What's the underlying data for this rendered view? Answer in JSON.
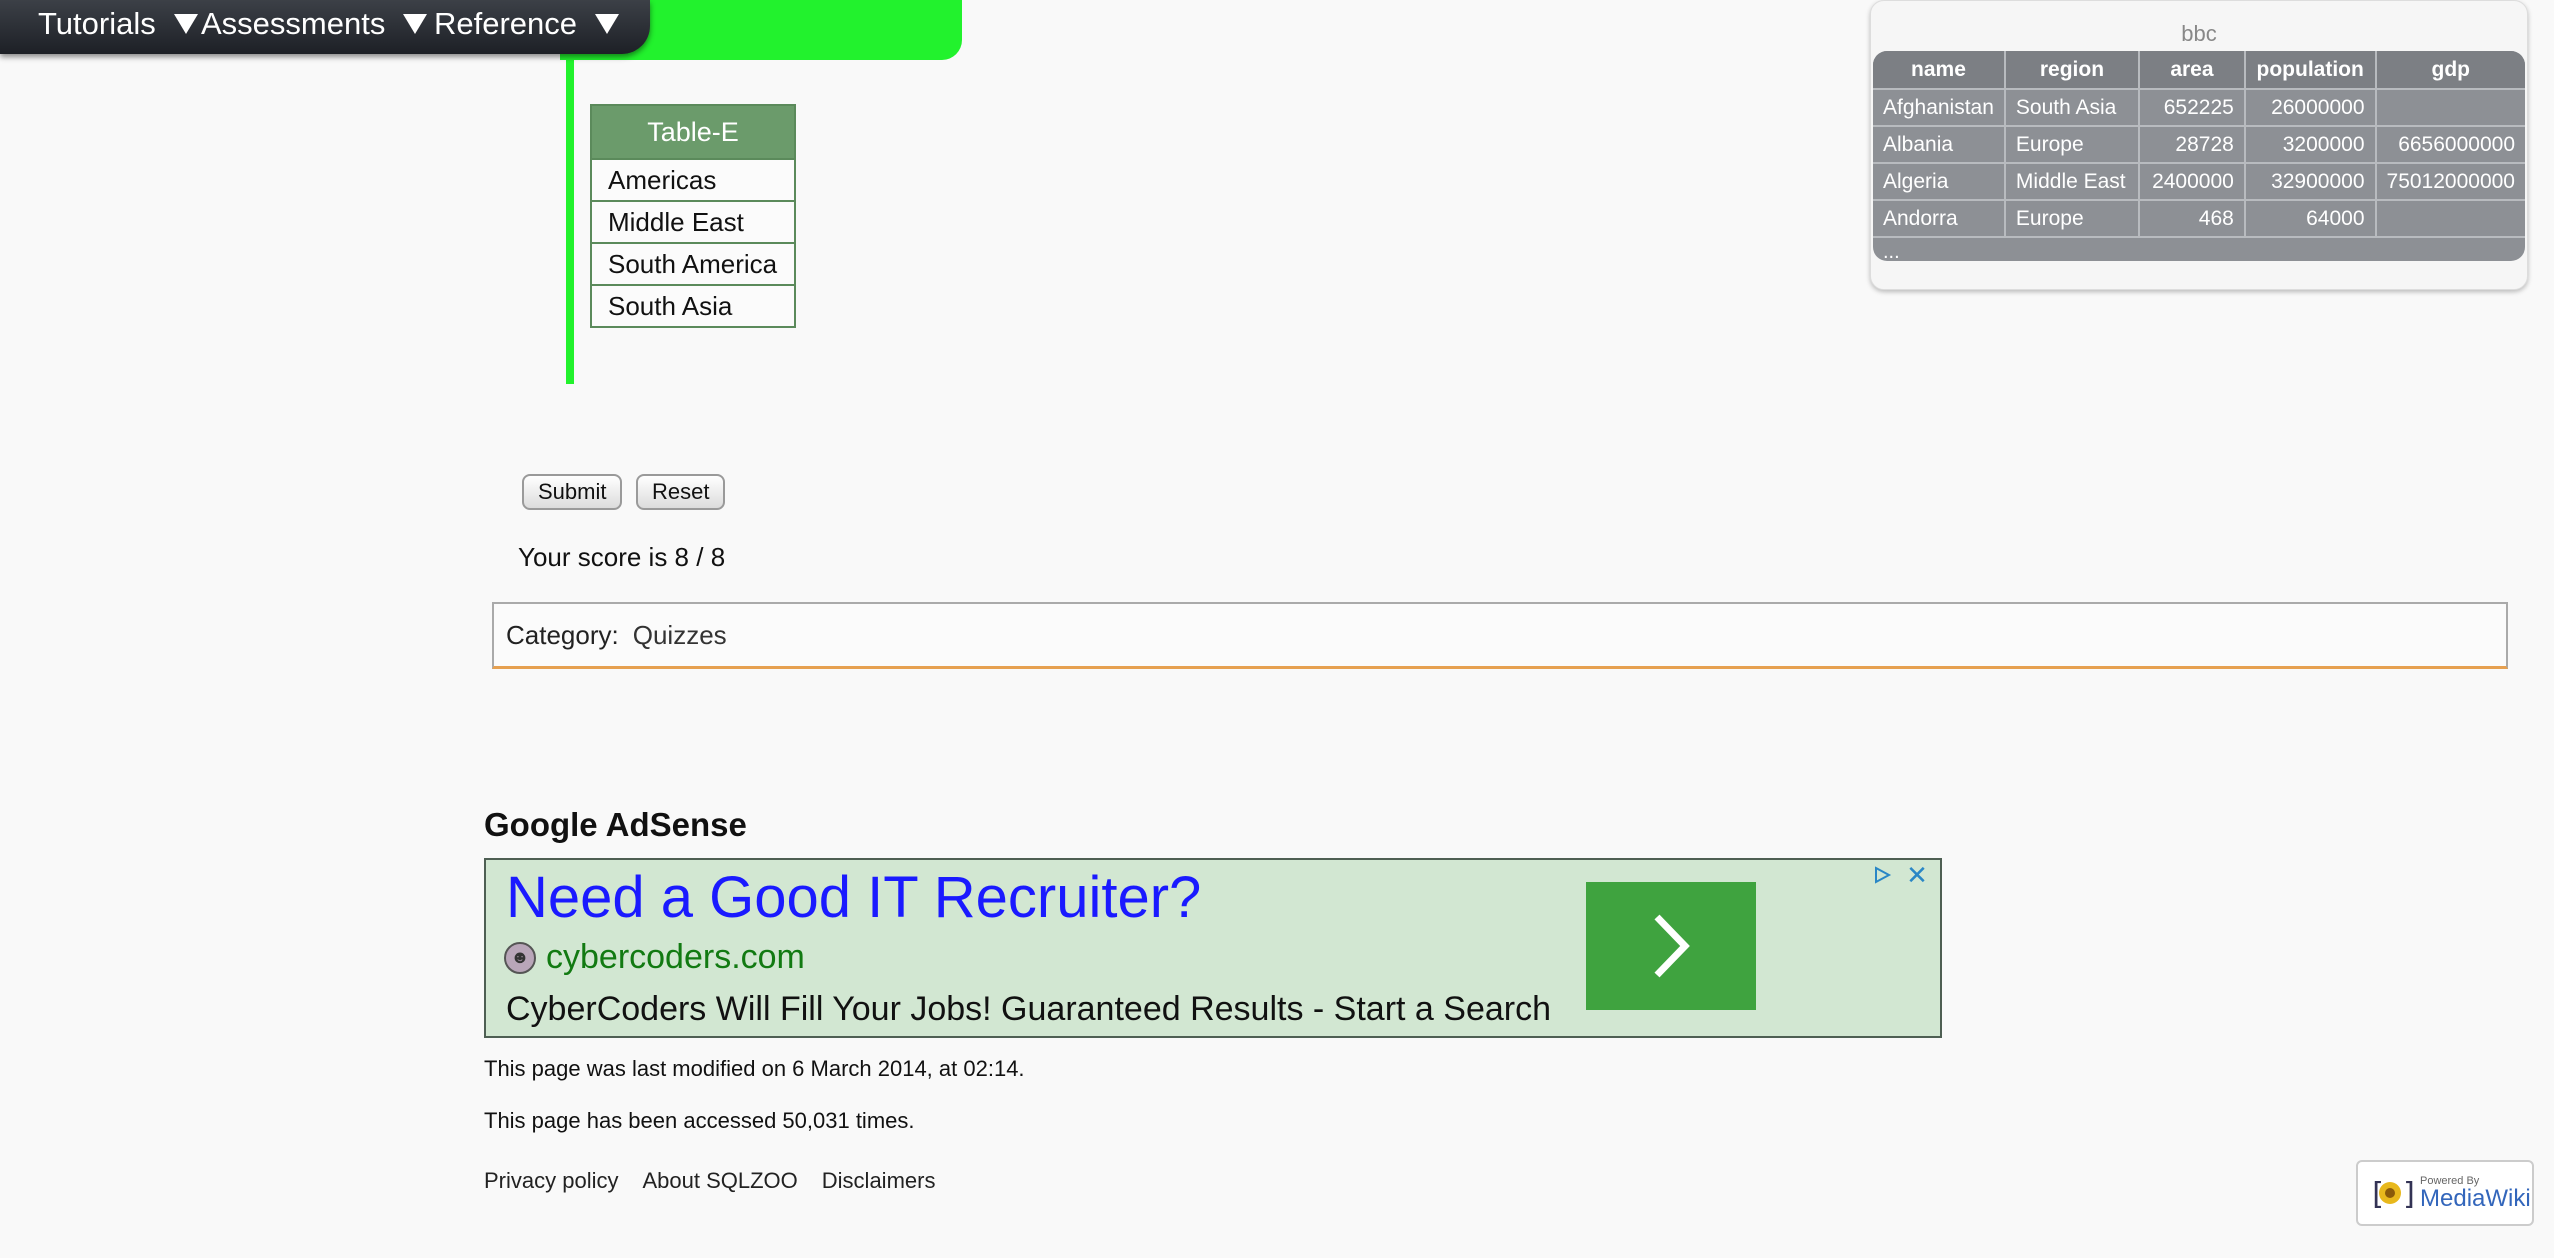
{
  "nav": {
    "items": [
      {
        "label": "Tutorials"
      },
      {
        "label": "Assessments"
      },
      {
        "label": "Reference"
      }
    ]
  },
  "table_e": {
    "title": "Table-E",
    "rows": [
      "Americas",
      "Middle East",
      "South America",
      "South Asia"
    ]
  },
  "bbc": {
    "caption": "bbc",
    "columns": [
      "name",
      "region",
      "area",
      "population",
      "gdp"
    ],
    "rows": [
      [
        "Afghanistan",
        "South Asia",
        "652225",
        "26000000",
        ""
      ],
      [
        "Albania",
        "Europe",
        "28728",
        "3200000",
        "6656000000"
      ],
      [
        "Algeria",
        "Middle East",
        "2400000",
        "32900000",
        "75012000000"
      ],
      [
        "Andorra",
        "Europe",
        "468",
        "64000",
        ""
      ]
    ],
    "ellipsis": "..."
  },
  "buttons": {
    "submit_label": "Submit",
    "reset_label": "Reset"
  },
  "score_text": "Your score is 8 / 8",
  "category": {
    "label": "Category:",
    "link": "Quizzes"
  },
  "adsense": {
    "title": "Google AdSense",
    "headline": "Need a Good IT Recruiter?",
    "domain": "cybercoders.com",
    "description": "CyberCoders Will Fill Your Jobs! Guaranteed Results - Start a Search",
    "cta_color": "#3fa33f"
  },
  "footer": {
    "last_modified": "This page was last modified on 6 March 2014, at 02:14.",
    "accessed": "This page has been accessed 50,031 times.",
    "links": [
      "Privacy policy",
      "About SQLZOO",
      "Disclaimers"
    ],
    "badge_powered": "Powered By",
    "badge_name": "MediaWiki"
  },
  "colors": {
    "accent_green": "#22f22d",
    "table_header_green": "#6b9b6b",
    "category_underline": "#e6a050"
  }
}
